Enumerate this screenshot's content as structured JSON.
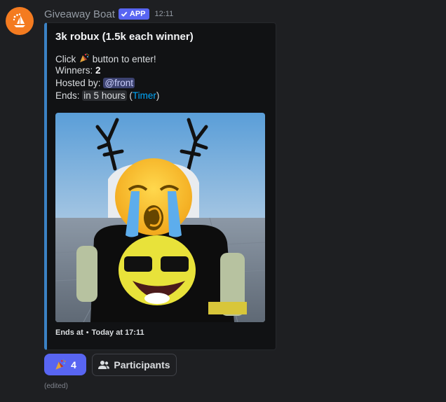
{
  "message": {
    "author": "Giveaway Boat",
    "app_badge": "APP",
    "timestamp": "12:11",
    "edited_label": "(edited)"
  },
  "embed": {
    "title": "3k robux (1.5k each winner)",
    "click_prefix": "Click",
    "click_suffix": "button to enter!",
    "winners_label": "Winners:",
    "winners_value": "2",
    "hosted_label": "Hosted by:",
    "host_mention": "@front",
    "ends_label": "Ends:",
    "ends_value": "in 5 hours",
    "timer_open": "(",
    "timer_link": "Timer",
    "timer_close": ")",
    "footer_label": "Ends at",
    "footer_sep": "•",
    "footer_time": "Today at 17:11",
    "accent_color": "#3b82c4"
  },
  "buttons": {
    "reaction_count": "4",
    "participants_label": "Participants"
  },
  "icons": {
    "reaction": "party-popper-icon",
    "participants": "person-icon",
    "badge": "checkmark-icon",
    "avatar": "boat-icon"
  }
}
